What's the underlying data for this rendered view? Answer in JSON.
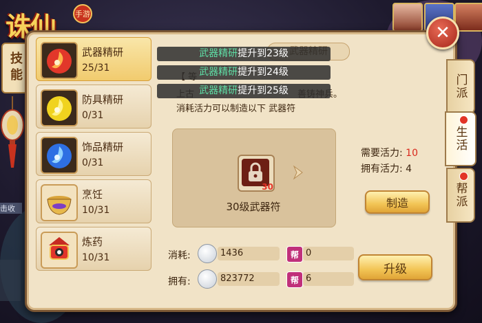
{
  "logo": {
    "text": "诛仙",
    "badge": "手游"
  },
  "skill_tag": {
    "label": "技能"
  },
  "hud": {
    "left_text": "击收"
  },
  "panel": {
    "close_label": "✕",
    "skills": [
      {
        "name": "武器精研",
        "level": "25/31",
        "active": true
      },
      {
        "name": "防具精研",
        "level": "0/31",
        "active": false
      },
      {
        "name": "饰品精研",
        "level": "0/31",
        "active": false
      },
      {
        "name": "烹饪",
        "level": "10/31",
        "active": false
      },
      {
        "name": "炼药",
        "level": "10/31",
        "active": false
      }
    ],
    "tabs": [
      {
        "label": "门派",
        "active": false,
        "dot": false
      },
      {
        "label": "生活",
        "active": true,
        "dot": true
      },
      {
        "label": "帮派",
        "active": false,
        "dot": true
      }
    ],
    "header_tab": "武器精研",
    "toasts": [
      {
        "highlight": "武器精研",
        "text": "提升到23级"
      },
      {
        "highlight": "武器精研",
        "text": "提升到24级"
      },
      {
        "highlight": "武器精研",
        "text": "提升到25级"
      }
    ],
    "desc_line1_prefix": "【 等",
    "desc_line2_prefix": "上古",
    "desc_line2_suffix": "善铸神兵。",
    "desc_line3": "消耗活力可以制造以下 武器符",
    "item": {
      "name": "30级武器符",
      "count": "30"
    },
    "energy_required_label": "需要活力:",
    "energy_required_value": "10",
    "energy_owned_label": "拥有活力:",
    "energy_owned_value": "4",
    "craft_button": "制造",
    "upgrade_button": "升级",
    "cost_label": "消耗:",
    "cost_silver": "1436",
    "cost_guild": "0",
    "own_label": "拥有:",
    "own_silver": "823772",
    "own_guild": "6",
    "guild_icon_text": "帮"
  }
}
